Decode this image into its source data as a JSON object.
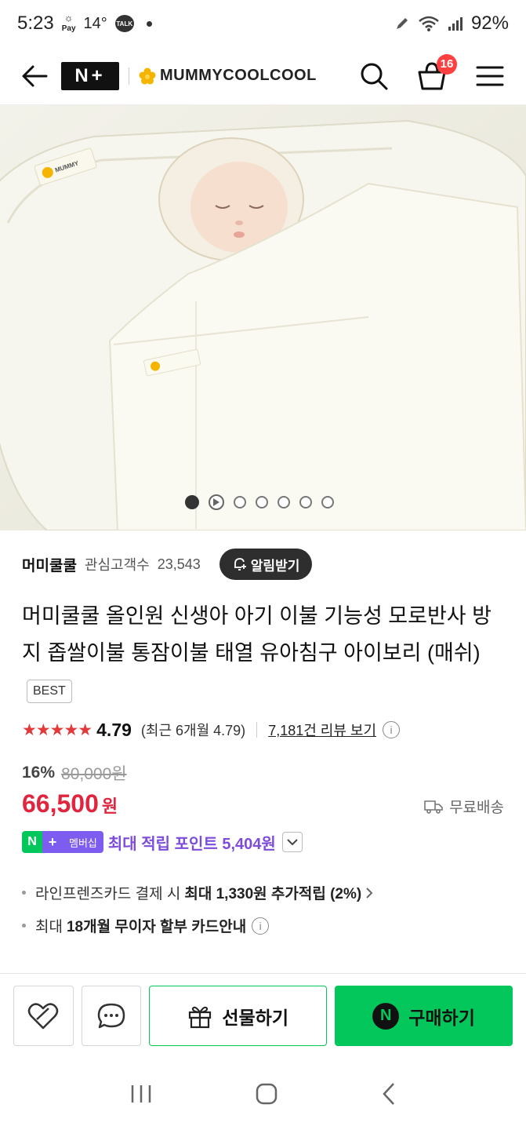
{
  "status_bar": {
    "time": "5:23",
    "pay_label": "Pay",
    "temperature": "14°",
    "talk_label": "TALK",
    "battery": "92%"
  },
  "header": {
    "nplus_label": "N+",
    "brand_name": "MUMMYCOOLCOOL",
    "cart_count": "16",
    "icons": [
      "back-arrow-icon",
      "search-icon",
      "cart-icon",
      "menu-icon"
    ]
  },
  "gallery": {
    "image_label_top": "MUMMY COOLCOOL",
    "pages": 7,
    "active_index": 0
  },
  "seller": {
    "name": "머미쿨쿨",
    "followers_label": "관심고객수",
    "followers": "23,543",
    "alarm_label": "알림받기"
  },
  "product": {
    "title": "머미쿨쿨 올인원 신생아 아기 이불 기능성 모로반사 방지 좁쌀이불 통잠이불 태열 유아침구 아이보리 (매쉬)",
    "badge": "BEST"
  },
  "rating": {
    "stars": "★★★★★",
    "score": "4.79",
    "recent": "(최근 6개월 4.79)",
    "reviews_link": "7,181건 리뷰 보기"
  },
  "price": {
    "discount": "16%",
    "original": "80,000원",
    "sale": "66,500",
    "currency": "원",
    "shipping": "무료배송"
  },
  "membership": {
    "n_label": "N",
    "plus_label": "+",
    "member_label": "멤버십",
    "points_text": "최대 적립 포인트 5,404원"
  },
  "benefits": {
    "card_prefix": "라인프렌즈카드 결제 시",
    "card_highlight": "최대 1,330원 추가적립 (2%)",
    "installment_prefix": "최대",
    "installment_highlight": "18개월 무이자 할부 카드안내"
  },
  "bottom_bar": {
    "gift_label": "선물하기",
    "buy_label": "구매하기",
    "buy_icon_letter": "N"
  },
  "colors": {
    "naver_green": "#03c75a",
    "price_red": "#e0263e",
    "member_purple": "#7d4cdb",
    "star_red": "#e23a3a"
  }
}
